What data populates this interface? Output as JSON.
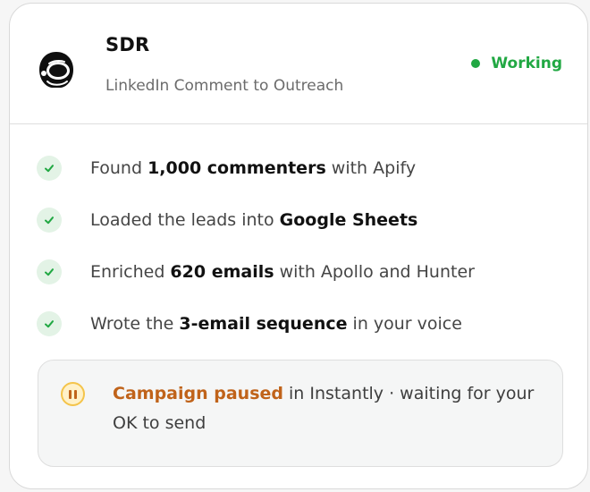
{
  "agent": {
    "name": "SDR",
    "subtitle": "LinkedIn Comment to Outreach",
    "icon": "astronaut-helmet-icon",
    "status": {
      "label": "Working",
      "color": "#21a843"
    }
  },
  "steps": [
    {
      "status": "done",
      "icon": "check-icon",
      "prefix": "Found ",
      "highlight": "1,000 commenters",
      "suffix": " with Apify"
    },
    {
      "status": "done",
      "icon": "check-icon",
      "prefix": "Loaded the leads into ",
      "highlight": "Google Sheets",
      "suffix": ""
    },
    {
      "status": "done",
      "icon": "check-icon",
      "prefix": "Enriched ",
      "highlight": "620 emails",
      "suffix": " with Apollo and Hunter"
    },
    {
      "status": "done",
      "icon": "check-icon",
      "prefix": "Wrote the ",
      "highlight": "3-email sequence",
      "suffix": " in your voice"
    }
  ],
  "notice": {
    "icon": "pause-icon",
    "strong": "Campaign paused",
    "text": " in Instantly · waiting for your OK to send",
    "accent": "#c0631a"
  },
  "colors": {
    "success": "#21a843",
    "check_bg": "#e3f3e6",
    "pause_ring": "#f4c44a",
    "pause_fill": "#fff1c8"
  }
}
